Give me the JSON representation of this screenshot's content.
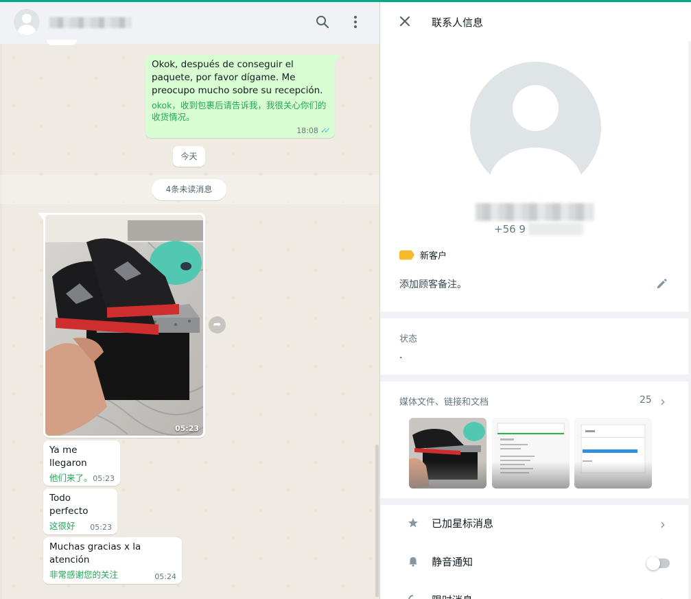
{
  "chat": {
    "outgoing": {
      "text": "Okok, después de conseguir el paquete, por favor dígame. Me preocupo mucho sobre su recepción.",
      "translation": "okok，收到包裹后请告诉我，我很关心你们的收货情况。",
      "time": "18:08"
    },
    "date_divider": "今天",
    "unread_divider": "4条未读消息",
    "image_message": {
      "time": "05:23"
    },
    "incoming": [
      {
        "text": "Ya me llegaron",
        "translation": "他们来了。",
        "time": "05:23"
      },
      {
        "text": "Todo perfecto",
        "translation": "这很好",
        "time": "05:23"
      },
      {
        "text": "Muchas gracias x la atención",
        "translation": "非常感谢您的关注",
        "time": "05:24"
      }
    ]
  },
  "contact_info": {
    "title": "联系人信息",
    "phone_prefix": "+56 9",
    "label": "新客户",
    "note_placeholder": "添加顾客备注。",
    "status_heading": "状态",
    "status_value": ".",
    "media_heading": "媒体文件、链接和文档",
    "media_count": "25",
    "starred": "已加星标消息",
    "mute": "静音通知",
    "disappearing": "限时消息"
  },
  "colors": {
    "accent": "#00a884",
    "outgoing_bubble": "#d9fdd3",
    "translation_text": "#1fa855",
    "read_ticks": "#53bdeb",
    "label_tag": "#f6b92b"
  },
  "icons": {
    "header": [
      "search-icon",
      "menu-icon"
    ],
    "info": [
      "close-icon",
      "edit-icon",
      "star-icon",
      "bell-icon",
      "timer-icon",
      "chevron-right-icon"
    ]
  }
}
